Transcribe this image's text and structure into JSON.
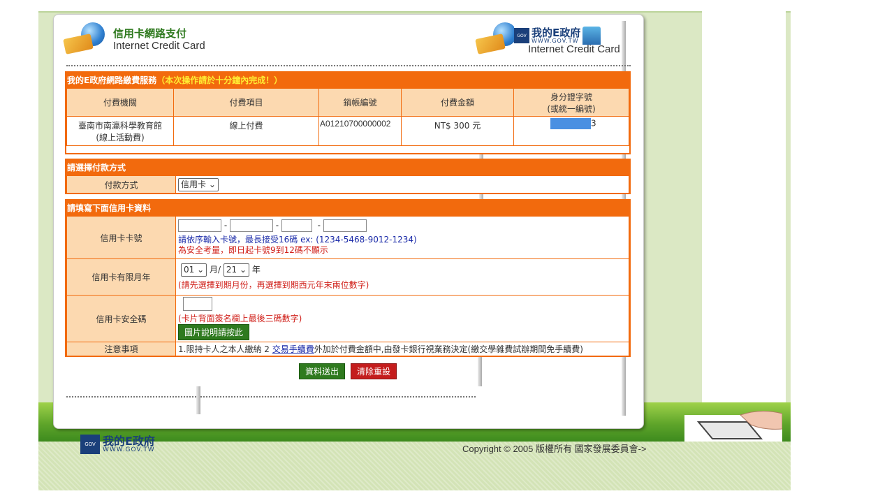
{
  "header": {
    "logo_cn": "信用卡網路支付",
    "logo_en": "Internet Credit Card",
    "right_logo_cn": "我的E政府",
    "right_logo_url": "WWW.GOV.TW",
    "right_logo_en": "Internet Credit Card",
    "gov_badge": "GOV"
  },
  "service": {
    "title": "我的E政府網路繳費服務",
    "note": "（本次操作請於十分鐘內完成！）",
    "columns": [
      "付費機關",
      "付費項目",
      "銷帳編號",
      "付費金額",
      "身分證字號",
      "(或統一編號)"
    ],
    "row": {
      "agency_line1": "臺南市南瀛科學教育館",
      "agency_line2": "(線上活動費)",
      "item": "線上付費",
      "account": "A01210700000002",
      "amount": "NT$ 300 元",
      "id_suffix": "3"
    }
  },
  "payment": {
    "title": "請選擇付款方式",
    "label": "付款方式",
    "method": "信用卡"
  },
  "card_info": {
    "title": "請填寫下面信用卡資料",
    "number_label": "信用卡卡號",
    "number_hint": "請依序輸入卡號，最長接受16碼 ex: (1234-5468-9012-1234)",
    "number_warning": "為安全考量，即日起卡號9到12碼不顯示",
    "expiry_label": "信用卡有限月年",
    "expiry_month": "01",
    "expiry_month_unit": "月/",
    "expiry_year": "21",
    "expiry_year_unit": "年",
    "expiry_hint": "(請先選擇到期月份，再選擇到期西元年末兩位數字)",
    "cvv_label": "信用卡安全碼",
    "cvv_hint": "(卡片背面簽名欄上最後三碼數字)",
    "cvv_button": "圖片說明請按此",
    "notice_label": "注意事項",
    "notice_prefix": "1.限持卡人之本人繳納 2 ",
    "notice_link": "交易手續費",
    "notice_suffix": "外加於付費金額中,由發卡銀行視業務決定(繳交學雜費試辦期間免手續費)"
  },
  "actions": {
    "submit": "資料送出",
    "reset": "清除重設"
  },
  "footer": {
    "gov_cn": "我的E政府",
    "gov_url": "WWW.GOV.TW",
    "gov_badge": "GOV",
    "copyright": "Copyright © 2005 版權所有 國家發展委員會->"
  }
}
